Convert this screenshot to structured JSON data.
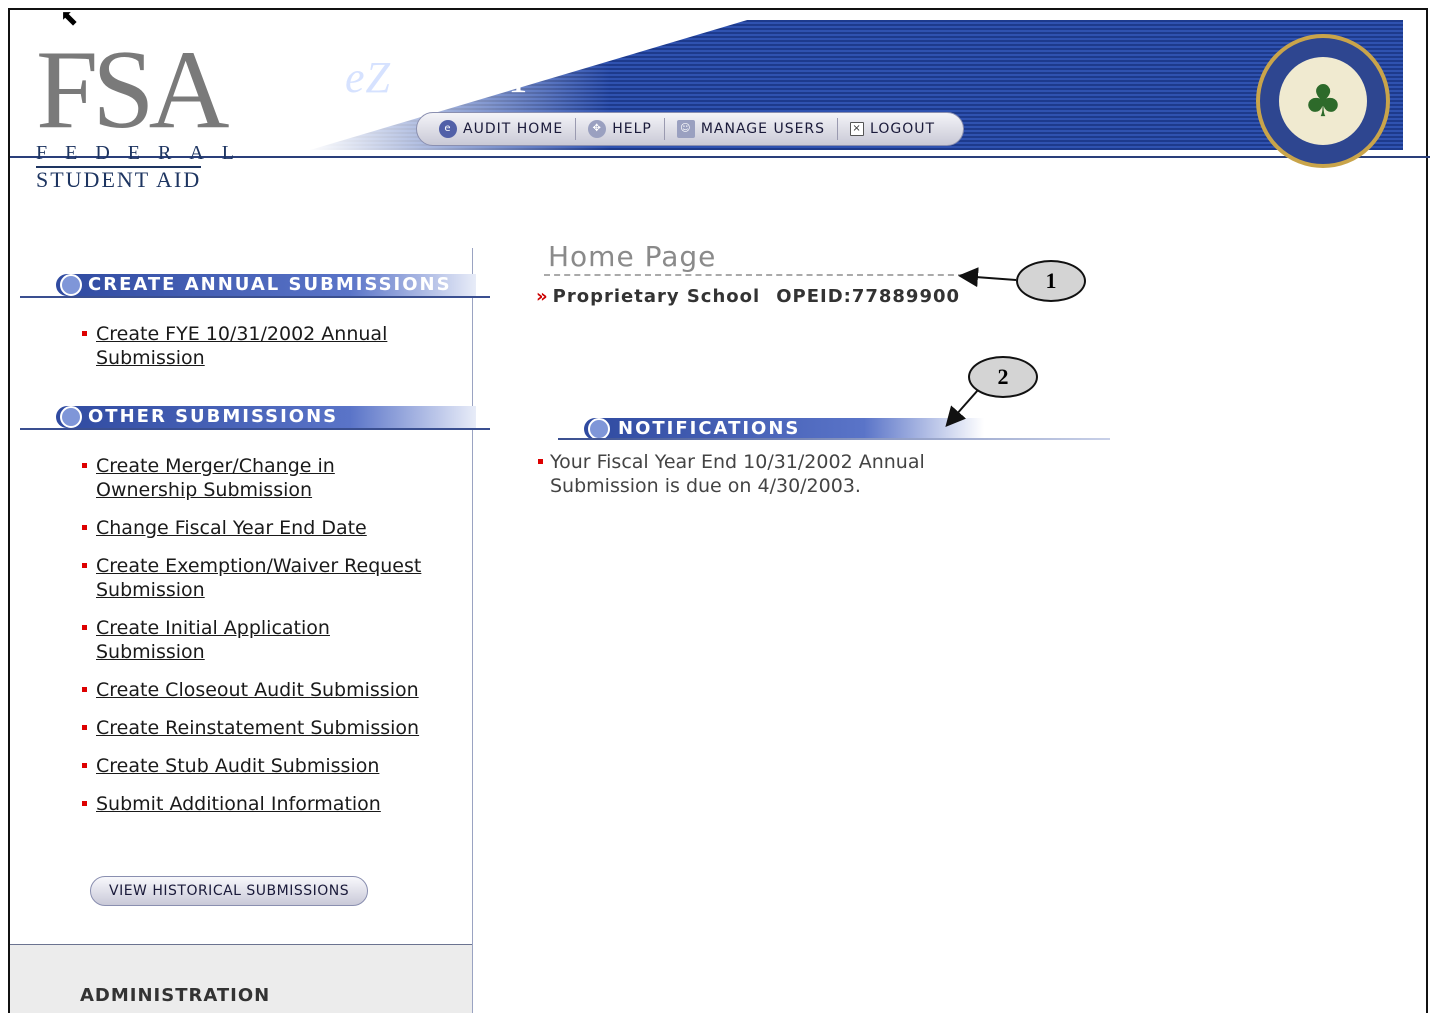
{
  "header": {
    "logo_letters": "FSA",
    "logo_federal": "FEDERAL",
    "logo_student_aid": "STUDENT AID",
    "app_title_ez": "eZ",
    "app_title_rest": "AUDIT",
    "nav": [
      {
        "label": "AUDIT HOME",
        "icon": "ez-icon"
      },
      {
        "label": "HELP",
        "icon": "help-icon"
      },
      {
        "label": "MANAGE USERS",
        "icon": "users-icon"
      },
      {
        "label": "LOGOUT",
        "icon": "logout-icon"
      }
    ],
    "seal_icon": "department-of-education-seal"
  },
  "sidebar": {
    "annual_heading": "CREATE ANNUAL SUBMISSIONS",
    "annual_links": [
      "Create FYE 10/31/2002 Annual Submission"
    ],
    "other_heading": "OTHER SUBMISSIONS",
    "other_links": [
      "Create Merger/Change in Ownership Submission",
      "Change Fiscal Year End Date",
      "Create Exemption/Waiver Request Submission",
      "Create Initial Application Submission",
      "Create Closeout Audit Submission",
      "Create Reinstatement Submission",
      "Create Stub Audit Submission",
      "Submit Additional Information"
    ],
    "historical_button": "VIEW HISTORICAL SUBMISSIONS",
    "admin_label": "ADMINISTRATION"
  },
  "main": {
    "page_title": "Home Page",
    "school_prefix": "»",
    "school_name": "Proprietary School",
    "opeid": "OPEID:77889900",
    "notifications_heading": "NOTIFICATIONS",
    "notification": "Your Fiscal Year End 10/31/2002 Annual Submission is due on 4/30/2003."
  },
  "callouts": {
    "one": "1",
    "two": "2"
  },
  "colors": {
    "brand_blue": "#2f4aa0",
    "bullet_red": "#dd0000"
  }
}
